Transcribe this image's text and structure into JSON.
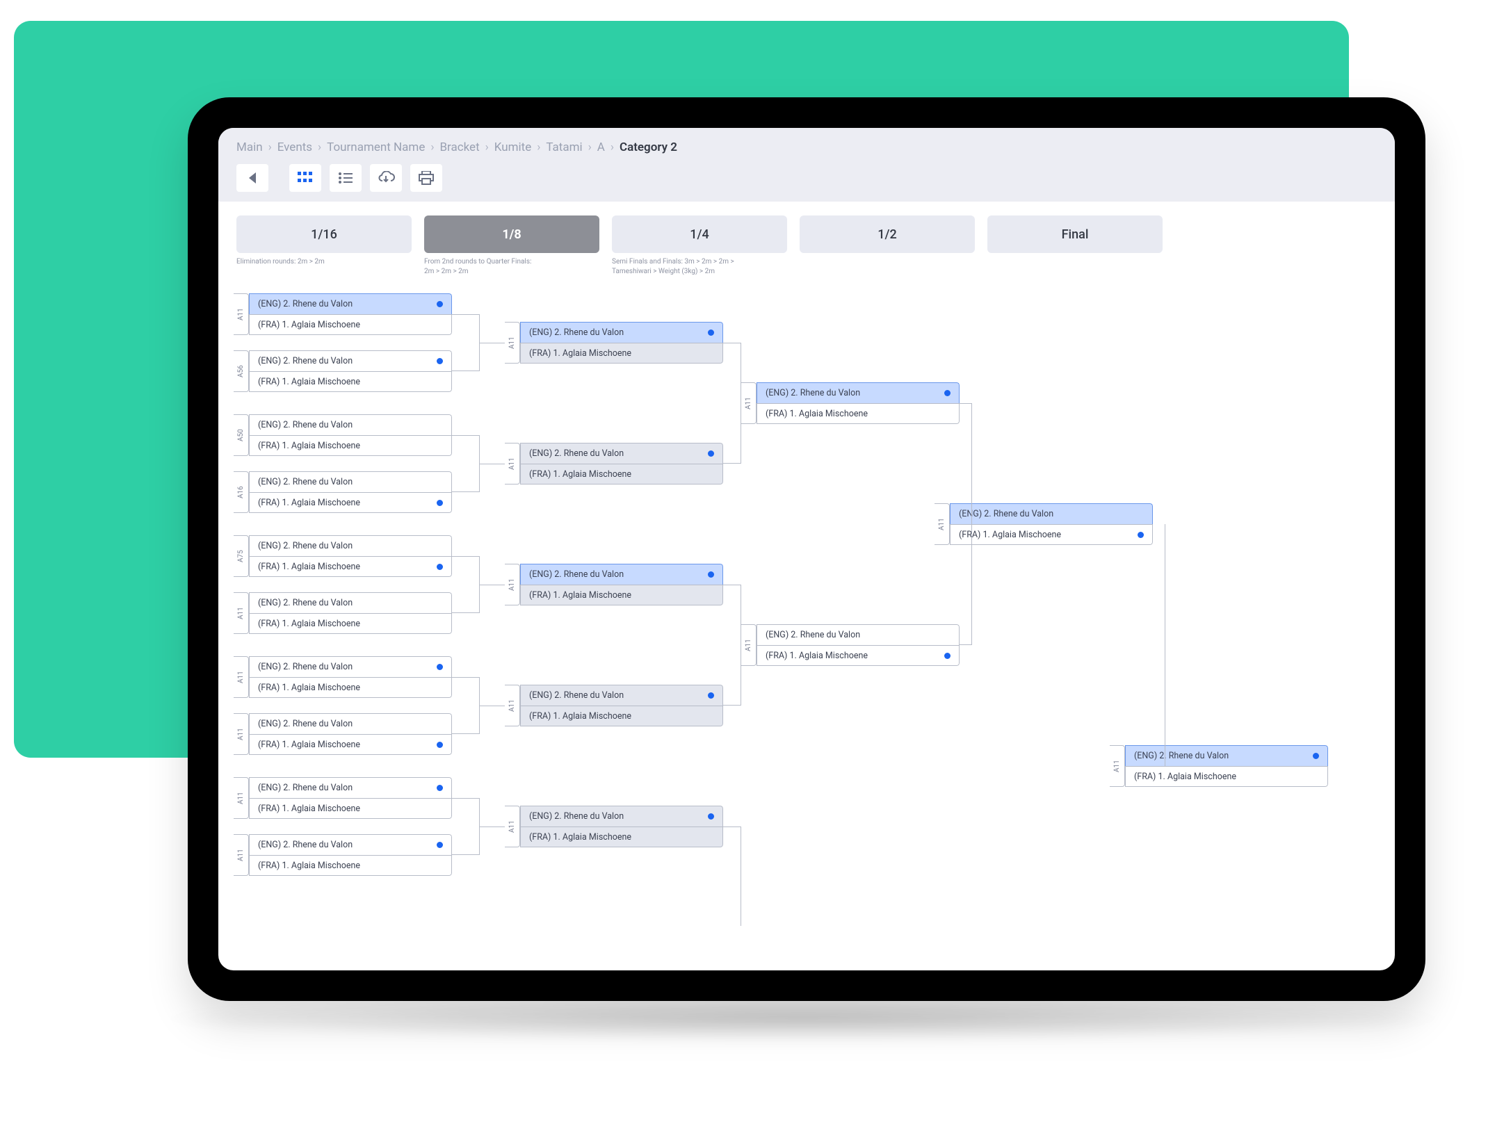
{
  "breadcrumbs": {
    "items": [
      "Main",
      "Events",
      "Tournament Name",
      "Bracket",
      "Kumite",
      "Tatami",
      "A"
    ],
    "current": "Category 2"
  },
  "toolbar": {
    "back": "back",
    "grid": "grid-view",
    "list": "list-view",
    "cloud": "cloud-download",
    "print": "print"
  },
  "rounds": [
    {
      "label": "1/16",
      "note": "Elimination rounds: 2m > 2m",
      "selected": false
    },
    {
      "label": "1/8",
      "note": "From 2nd rounds to Quarter Finals:\n2m > 2m > 2m",
      "selected": true
    },
    {
      "label": "1/4",
      "note": "Semi Finals and Finals: 3m > 2m > 2m >\nTameshiwari > Weight (3kg) > 2m",
      "selected": false
    },
    {
      "label": "1/2",
      "note": "",
      "selected": false
    },
    {
      "label": "Final",
      "note": "",
      "selected": false
    }
  ],
  "player_a": "(ENG) 2. Rhene du Valon",
  "player_b": "(FRA) 1. Aglaia Mischoene",
  "col1": [
    {
      "id": "A11",
      "top_winner": true,
      "dot_on": "top"
    },
    {
      "id": "A56",
      "top_winner": false,
      "dot_on": "top"
    },
    {
      "id": "A50",
      "top_winner": false,
      "dot_on": "none"
    },
    {
      "id": "A16",
      "top_winner": false,
      "dot_on": "bottom"
    },
    {
      "id": "A75",
      "top_winner": false,
      "dot_on": "bottom"
    },
    {
      "id": "A11",
      "top_winner": false,
      "dot_on": "none"
    },
    {
      "id": "A11",
      "top_winner": false,
      "dot_on": "top"
    },
    {
      "id": "A11",
      "top_winner": false,
      "dot_on": "bottom"
    },
    {
      "id": "A11",
      "top_winner": false,
      "dot_on": "top"
    },
    {
      "id": "A11",
      "top_winner": false,
      "dot_on": "top"
    }
  ],
  "col2": [
    {
      "id": "A11",
      "top_winner": true,
      "dot_on": "top",
      "grey_bottom": true
    },
    {
      "id": "A11",
      "top_winner": false,
      "dot_on": "top",
      "grey_both": true
    },
    {
      "id": "A11",
      "top_winner": true,
      "dot_on": "top",
      "grey_bottom": true
    },
    {
      "id": "A11",
      "top_winner": false,
      "dot_on": "top",
      "grey_both": true
    },
    {
      "id": "A11",
      "top_winner": false,
      "dot_on": "top",
      "grey_both": true
    }
  ],
  "col3": [
    {
      "id": "A11",
      "top_winner": true,
      "dot_on": "top"
    },
    {
      "id": "A11",
      "top_winner": false,
      "dot_on": "bottom"
    }
  ],
  "col4": [
    {
      "id": "A11",
      "top_winner": true,
      "dot_on": "bottom"
    }
  ],
  "col5": [
    {
      "id": "A11",
      "top_winner": true,
      "dot_on": "top"
    }
  ]
}
